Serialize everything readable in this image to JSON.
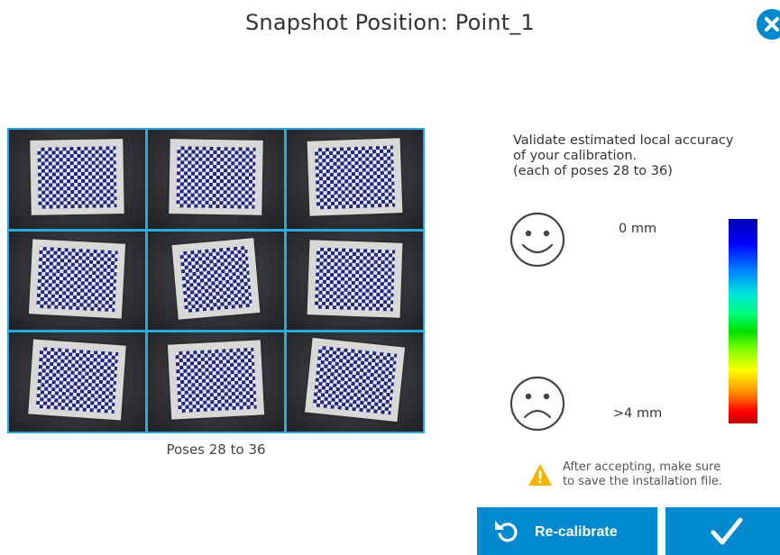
{
  "dialog": {
    "title": "Snapshot Position: Point_1"
  },
  "poses": {
    "caption": "Poses 28 to 36",
    "thumbnails": [
      "checkerboard",
      "checkerboard",
      "checkerboard",
      "checkerboard",
      "checkerboard",
      "checkerboard",
      "checkerboard",
      "checkerboard",
      "checkerboard"
    ]
  },
  "accuracy": {
    "intro_lines": [
      "Validate estimated local accuracy",
      "of your calibration.",
      "(each of poses 28 to 36)"
    ],
    "low_label": "0 mm",
    "high_label": ">4 mm",
    "happy_icon": "smiley-face-icon",
    "sad_icon": "sad-face-icon",
    "colorbar_colors": [
      "#0000b0",
      "#0000ff",
      "#0080ff",
      "#00e0e0",
      "#00ff80",
      "#00e000",
      "#80ff00",
      "#ffff00",
      "#ff8000",
      "#ff0000",
      "#c00000"
    ]
  },
  "warning": {
    "icon": "warning-triangle-icon",
    "lines": [
      "After accepting, make sure",
      "to save the installation file."
    ]
  },
  "buttons": {
    "recalibrate_label": "Re-calibrate",
    "recalibrate_icon": "undo-arrow-icon",
    "accept_icon": "checkmark-icon",
    "close_icon": "close-icon"
  },
  "colors": {
    "accent": "#0089cf",
    "grid_border": "#29a9df",
    "warning": "#f5b400"
  }
}
